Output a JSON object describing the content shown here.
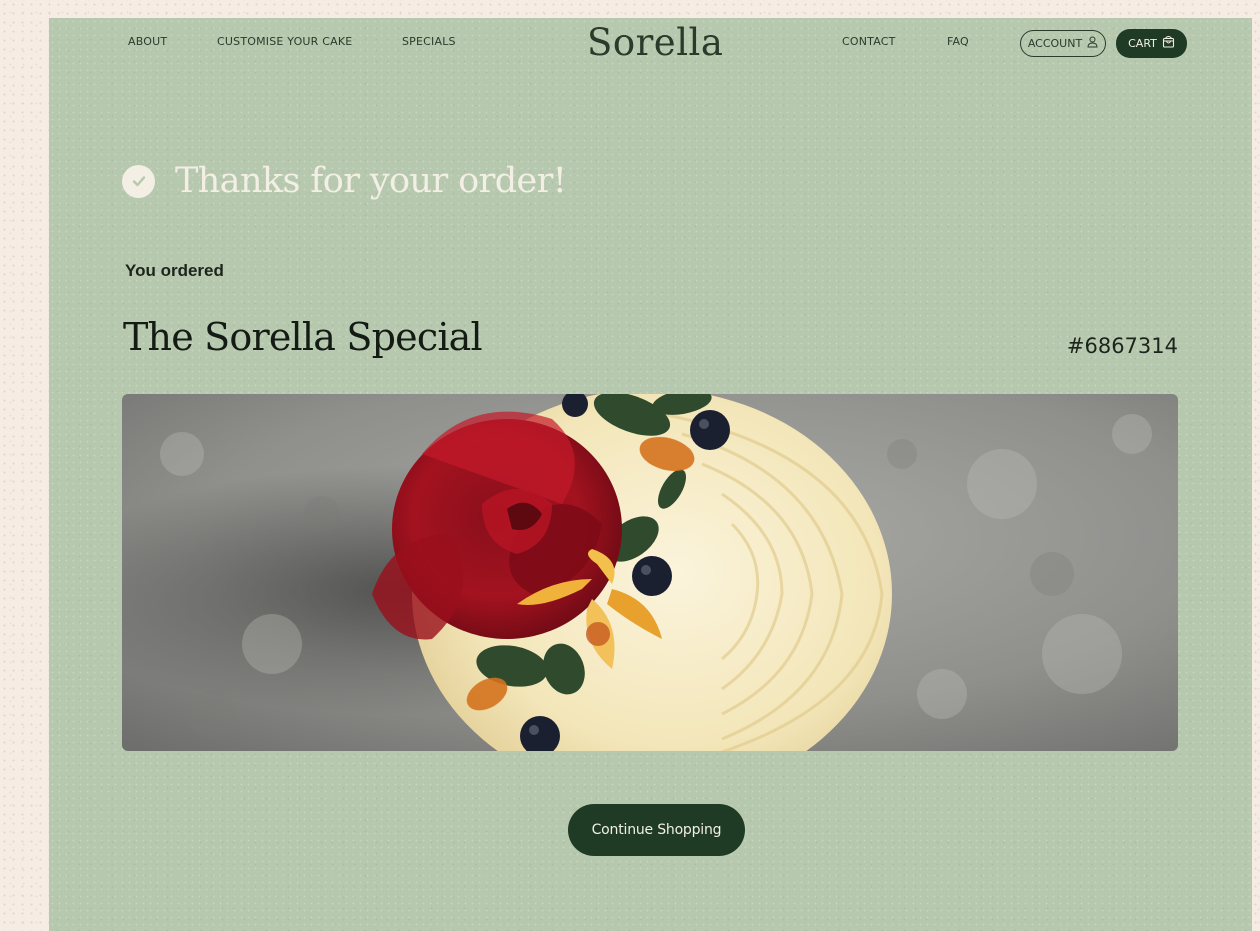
{
  "brand": {
    "logo_text": "Sorella"
  },
  "nav": {
    "left": [
      {
        "label": "ABOUT"
      },
      {
        "label": "CUSTOMISE YOUR CAKE"
      },
      {
        "label": "SPECIALS"
      }
    ],
    "right": [
      {
        "label": "CONTACT"
      },
      {
        "label": "FAQ"
      }
    ],
    "account_label": "ACCOUNT",
    "cart_label": "CART"
  },
  "confirmation": {
    "title": "Thanks for your order!",
    "icon": "check-circle-icon"
  },
  "order": {
    "intro": "You ordered",
    "product_name": "The Sorella Special",
    "number": "#6867314",
    "image": "cake-photo"
  },
  "actions": {
    "continue_label": "Continue Shopping"
  },
  "colors": {
    "page_bg": "#f6ece4",
    "panel_bg": "#b6c9ae",
    "accent_dark": "#1f3b26",
    "light_text": "#f4efe4"
  }
}
